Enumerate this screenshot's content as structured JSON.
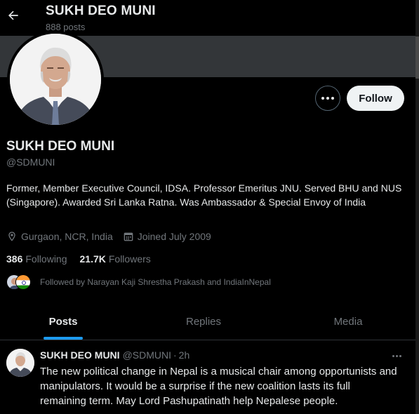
{
  "header": {
    "title": "SUKH DEO MUNI",
    "post_count": "888 posts"
  },
  "profile": {
    "name": "SUKH DEO MUNI",
    "handle": "@SDMUNI",
    "bio": "Former, Member Executive Council, IDSA. Professor Emeritus JNU. Served BHU and NUS (Singapore). Awarded Sri Lanka Ratna. Was Ambassador & Special Envoy of India",
    "location": "Gurgaon,  NCR, India",
    "joined": "Joined July 2009",
    "following_count": "386",
    "following_label": "Following",
    "followers_count": "21.7K",
    "followers_label": "Followers",
    "followed_by": "Followed by Narayan Kaji Shrestha Prakash and IndiaInNepal",
    "follow_button": "Follow"
  },
  "tabs": [
    {
      "label": "Posts",
      "active": true
    },
    {
      "label": "Replies",
      "active": false
    },
    {
      "label": "Media",
      "active": false
    }
  ],
  "tweet": {
    "author": "SUKH DEO MUNI",
    "handle": "@SDMUNI",
    "separator": "·",
    "time": "2h",
    "text": "The new political change in Nepal is a musical chair among opportunists and manipulators. It would be a surprise if the new coalition lasts its full remaining term. May Lord Pashupatinath help Nepalese people."
  },
  "colors": {
    "background": "#000000",
    "banner": "#333639",
    "text": "#e7e9ea",
    "muted": "#71767b",
    "accent": "#1d9bf0",
    "follow_bg": "#eff3f4"
  },
  "icons": [
    "back-arrow-icon",
    "more-icon",
    "location-icon",
    "calendar-icon"
  ]
}
